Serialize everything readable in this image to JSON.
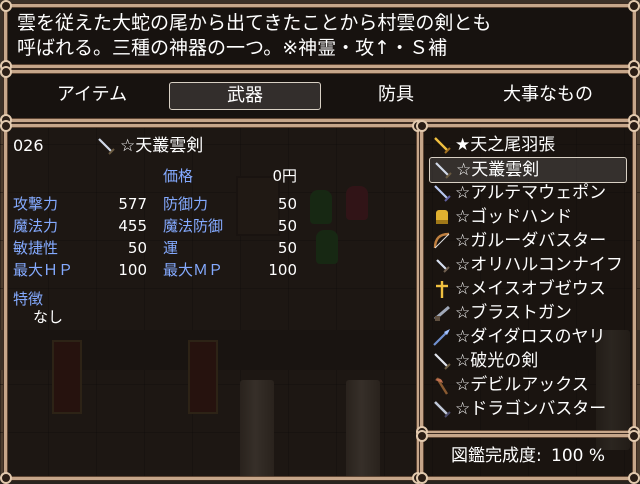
{
  "help": {
    "line1": "雲を従えた大蛇の尾から出てきたことから村雲の剣とも",
    "line2": "呼ばれる。三種の神器の一つ。※神霊・攻↑・Ｓ補"
  },
  "categories": [
    "アイテム",
    "武器",
    "防具",
    "大事なもの"
  ],
  "selected_category": "武器",
  "detail": {
    "number": "026",
    "name": "☆天叢雲剣",
    "price_label": "価格",
    "price_value": "0円",
    "stats": [
      {
        "label": "攻撃力",
        "value": "577"
      },
      {
        "label": "防御力",
        "value": "50"
      },
      {
        "label": "魔法力",
        "value": "455"
      },
      {
        "label": "魔法防御",
        "value": "50"
      },
      {
        "label": "敏捷性",
        "value": "50"
      },
      {
        "label": "運",
        "value": "50"
      },
      {
        "label": "最大ＨＰ",
        "value": "100"
      },
      {
        "label": "最大ＭＰ",
        "value": "100"
      }
    ],
    "traits_label": "特徴",
    "traits_value": "なし"
  },
  "weapon_list": [
    {
      "name": "★天之尾羽張",
      "icon": "sword-gold-icon"
    },
    {
      "name": "☆天叢雲剣",
      "icon": "sword-icon"
    },
    {
      "name": "☆アルテマウェポン",
      "icon": "sword-icon"
    },
    {
      "name": "☆ゴッドハンド",
      "icon": "gauntlet-icon"
    },
    {
      "name": "☆ガルーダバスター",
      "icon": "bow-icon"
    },
    {
      "name": "☆オリハルコンナイフ",
      "icon": "dagger-icon"
    },
    {
      "name": "☆メイスオブゼウス",
      "icon": "mace-icon"
    },
    {
      "name": "☆ブラストガン",
      "icon": "gun-icon"
    },
    {
      "name": "☆ダイダロスのヤリ",
      "icon": "spear-icon"
    },
    {
      "name": "☆破光の剣",
      "icon": "sword-icon"
    },
    {
      "name": "☆デビルアックス",
      "icon": "axe-icon"
    },
    {
      "name": "☆ドラゴンバスター",
      "icon": "sword-icon"
    }
  ],
  "selected_weapon_index": 1,
  "completion": {
    "label": "図鑑完成度:",
    "value": "100 %"
  },
  "colors": {
    "system_text": "#84aaff",
    "window_border": "#c6a68a"
  }
}
